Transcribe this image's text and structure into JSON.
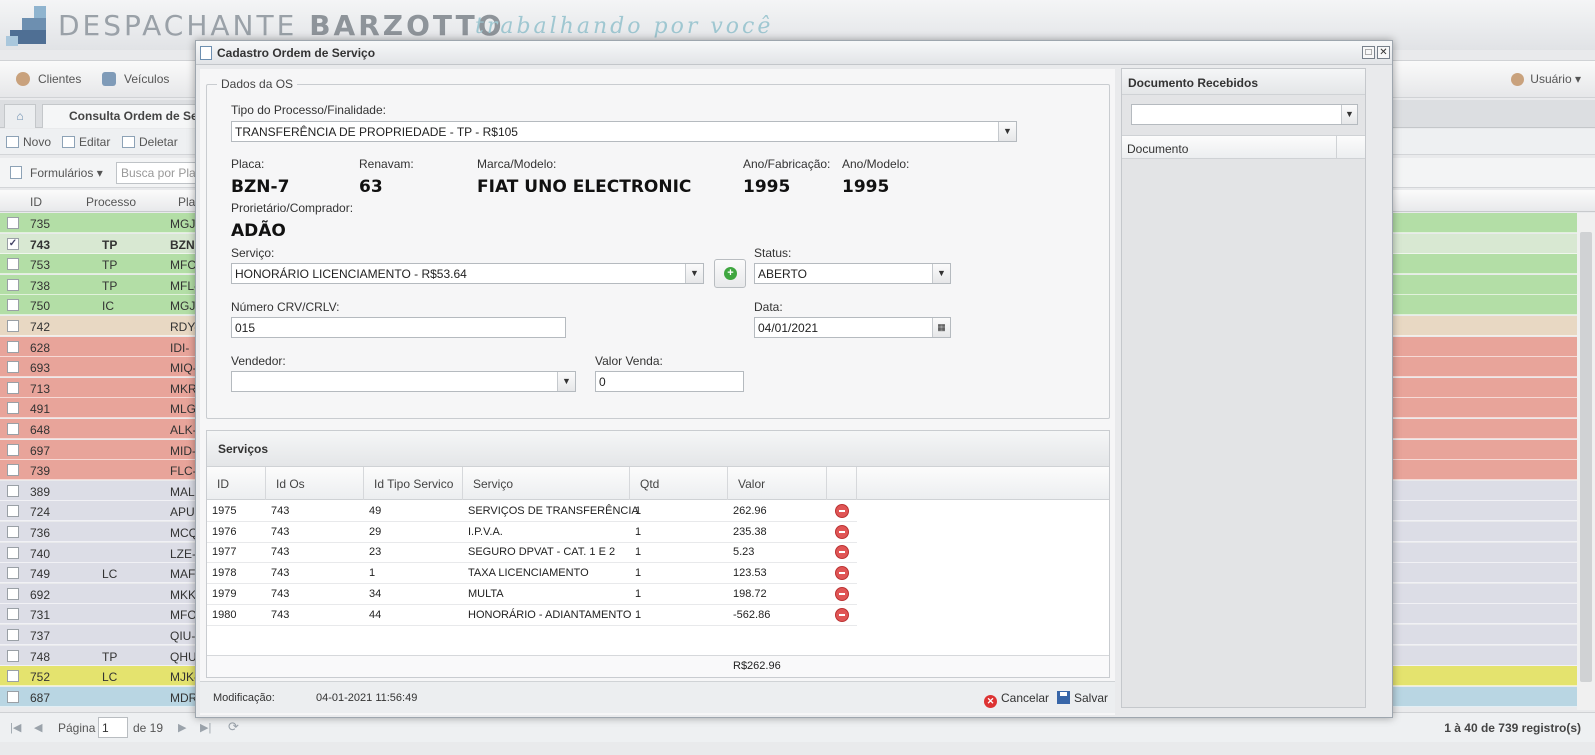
{
  "app": {
    "brand_light": "DESPACHANTE",
    "brand_bold": "BARZOTTO",
    "tagline": "trabalhando por você",
    "menu": [
      {
        "label": "Clientes"
      },
      {
        "label": "Veículos"
      }
    ],
    "user_menu": "Usuário",
    "tab_label": "Consulta Ordem de Serviço",
    "toolbar": {
      "new": "Novo",
      "edit": "Editar",
      "delete": "Deletar"
    },
    "forms_menu": "Formulários",
    "search_placeholder": "Busca por Placa",
    "grid_columns": [
      "ID",
      "Processo",
      "Placa"
    ],
    "grid_rows": [
      {
        "id": "735",
        "proc": "",
        "plate": "MGJ-",
        "color": "#b3dea6",
        "checked": false
      },
      {
        "id": "743",
        "proc": "TP",
        "plate": "BZN-",
        "color": "#d8e8d2",
        "checked": true
      },
      {
        "id": "753",
        "proc": "TP",
        "plate": "MFC-",
        "color": "#b3dea6",
        "checked": false
      },
      {
        "id": "738",
        "proc": "TP",
        "plate": "MFL-",
        "color": "#b3dea6",
        "checked": false
      },
      {
        "id": "750",
        "proc": "IC",
        "plate": "MGJ-",
        "color": "#b3dea6",
        "checked": false
      },
      {
        "id": "742",
        "proc": "",
        "plate": "RDY-",
        "color": "#e8d8c3",
        "checked": false
      },
      {
        "id": "628",
        "proc": "",
        "plate": "IDI-",
        "color": "#e8a49a",
        "checked": false
      },
      {
        "id": "693",
        "proc": "",
        "plate": "MIQ-",
        "color": "#e8a49a",
        "checked": false
      },
      {
        "id": "713",
        "proc": "",
        "plate": "MKR-",
        "color": "#e8a49a",
        "checked": false
      },
      {
        "id": "491",
        "proc": "",
        "plate": "MLG-",
        "color": "#e8a49a",
        "checked": false
      },
      {
        "id": "648",
        "proc": "",
        "plate": "ALK-",
        "color": "#e8a49a",
        "checked": false
      },
      {
        "id": "697",
        "proc": "",
        "plate": "MID-",
        "color": "#e8a49a",
        "checked": false
      },
      {
        "id": "739",
        "proc": "",
        "plate": "FLC-",
        "color": "#e8a49a",
        "checked": false
      },
      {
        "id": "389",
        "proc": "",
        "plate": "MAL-",
        "color": "#dcdde6",
        "checked": false
      },
      {
        "id": "724",
        "proc": "",
        "plate": "APU-",
        "color": "#dcdde6",
        "checked": false
      },
      {
        "id": "736",
        "proc": "",
        "plate": "MCQ-",
        "color": "#dcdde6",
        "checked": false
      },
      {
        "id": "740",
        "proc": "",
        "plate": "LZE-",
        "color": "#dcdde6",
        "checked": false
      },
      {
        "id": "749",
        "proc": "LC",
        "plate": "MAF-",
        "color": "#dcdde6",
        "checked": false
      },
      {
        "id": "692",
        "proc": "",
        "plate": "MKK-",
        "color": "#dcdde6",
        "checked": false
      },
      {
        "id": "731",
        "proc": "",
        "plate": "MFO-",
        "color": "#dcdde6",
        "checked": false
      },
      {
        "id": "737",
        "proc": "",
        "plate": "QIU-",
        "color": "#dcdde6",
        "checked": false
      },
      {
        "id": "748",
        "proc": "TP",
        "plate": "QHU-",
        "color": "#dcdde6",
        "checked": false
      },
      {
        "id": "752",
        "proc": "LC",
        "plate": "MJK-",
        "color": "#e4e36e",
        "checked": false
      },
      {
        "id": "687",
        "proc": "",
        "plate": "MDR-",
        "color": "#b9d6e3",
        "checked": false
      }
    ],
    "pager": {
      "page_label": "Página",
      "page": "1",
      "of": "de 19",
      "count": "1 à 40 de 739 registro(s)"
    }
  },
  "modal": {
    "title": "Cadastro Ordem de Serviço",
    "fieldset_legend": "Dados da OS",
    "process_label": "Tipo do Processo/Finalidade:",
    "process_value": "TRANSFERÊNCIA DE PROPRIEDADE - TP - R$105",
    "plate_label": "Placa:",
    "plate_value": "BZN-7",
    "renavam_label": "Renavam:",
    "renavam_value": "63",
    "model_label": "Marca/Modelo:",
    "model_value": "FIAT UNO ELECTRONIC",
    "year_fab_label": "Ano/Fabricação:",
    "year_fab_value": "1995",
    "year_model_label": "Ano/Modelo:",
    "year_model_value": "1995",
    "owner_label": "Prorietário/Comprador:",
    "owner_value": "ADÃO",
    "service_label": "Serviço:",
    "service_value": "HONORÁRIO LICENCIAMENTO - R$53.64",
    "status_label": "Status:",
    "status_value": "ABERTO",
    "crv_label": "Número CRV/CRLV:",
    "crv_value": "015",
    "date_label": "Data:",
    "date_value": "04/01/2021",
    "seller_label": "Vendedor:",
    "seller_value": "",
    "sale_label": "Valor Venda:",
    "sale_value": "0",
    "services_title": "Serviços",
    "services_columns": [
      "ID",
      "Id Os",
      "Id Tipo Servico",
      "Serviço",
      "Qtd",
      "Valor"
    ],
    "services_rows": [
      {
        "id": "1975",
        "os": "743",
        "tipo": "49",
        "servico": "SERVIÇOS DE TRANSFERÊNCIA",
        "qtd": "1",
        "valor": "262.96"
      },
      {
        "id": "1976",
        "os": "743",
        "tipo": "29",
        "servico": "I.P.V.A.",
        "qtd": "1",
        "valor": "235.38"
      },
      {
        "id": "1977",
        "os": "743",
        "tipo": "23",
        "servico": "SEGURO DPVAT - CAT. 1 E 2",
        "qtd": "1",
        "valor": "5.23"
      },
      {
        "id": "1978",
        "os": "743",
        "tipo": "1",
        "servico": "TAXA LICENCIAMENTO",
        "qtd": "1",
        "valor": "123.53"
      },
      {
        "id": "1979",
        "os": "743",
        "tipo": "34",
        "servico": "MULTA",
        "qtd": "1",
        "valor": "198.72"
      },
      {
        "id": "1980",
        "os": "743",
        "tipo": "44",
        "servico": "HONORÁRIO - ADIANTAMENTO",
        "qtd": "1",
        "valor": "-562.86"
      }
    ],
    "services_total": "R$262.96",
    "modified_label": "Modificação:",
    "modified_value": "04-01-2021 11:56:49",
    "cancel_label": "Cancelar",
    "save_label": "Salvar",
    "docs_title": "Documento Recebidos",
    "docs_column": "Documento"
  }
}
